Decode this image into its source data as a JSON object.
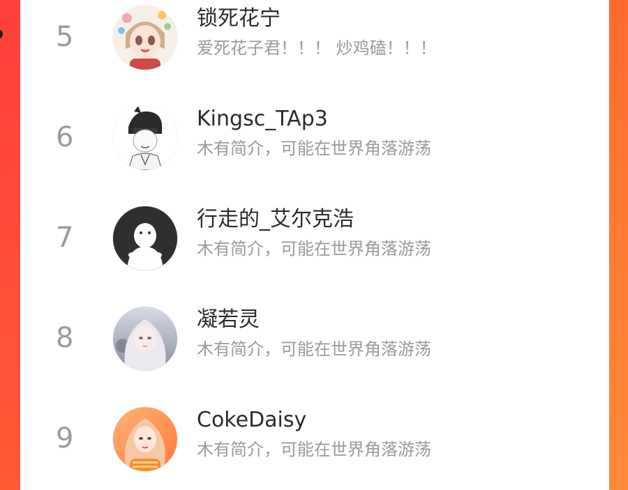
{
  "accent": "#ff5a3a",
  "users": [
    {
      "rank": "5",
      "name": "锁死花宁",
      "bio": "爱死花子君！！！ 炒鸡磕！！！",
      "avatar": "anime-girl-avatar"
    },
    {
      "rank": "6",
      "name": "Kingsc_TAp3",
      "bio": "木有简介，可能在世界角落游荡",
      "avatar": "sketch-boy-avatar"
    },
    {
      "rank": "7",
      "name": "行走的_艾尔克浩",
      "bio": "木有简介，可能在世界角落游荡",
      "avatar": "default-user-avatar"
    },
    {
      "rank": "8",
      "name": "凝若灵",
      "bio": "木有简介，可能在世界角落游荡",
      "avatar": "white-hair-girl-avatar"
    },
    {
      "rank": "9",
      "name": "CokeDaisy",
      "bio": "木有简介，可能在世界角落游荡",
      "avatar": "orange-girl-avatar"
    }
  ]
}
